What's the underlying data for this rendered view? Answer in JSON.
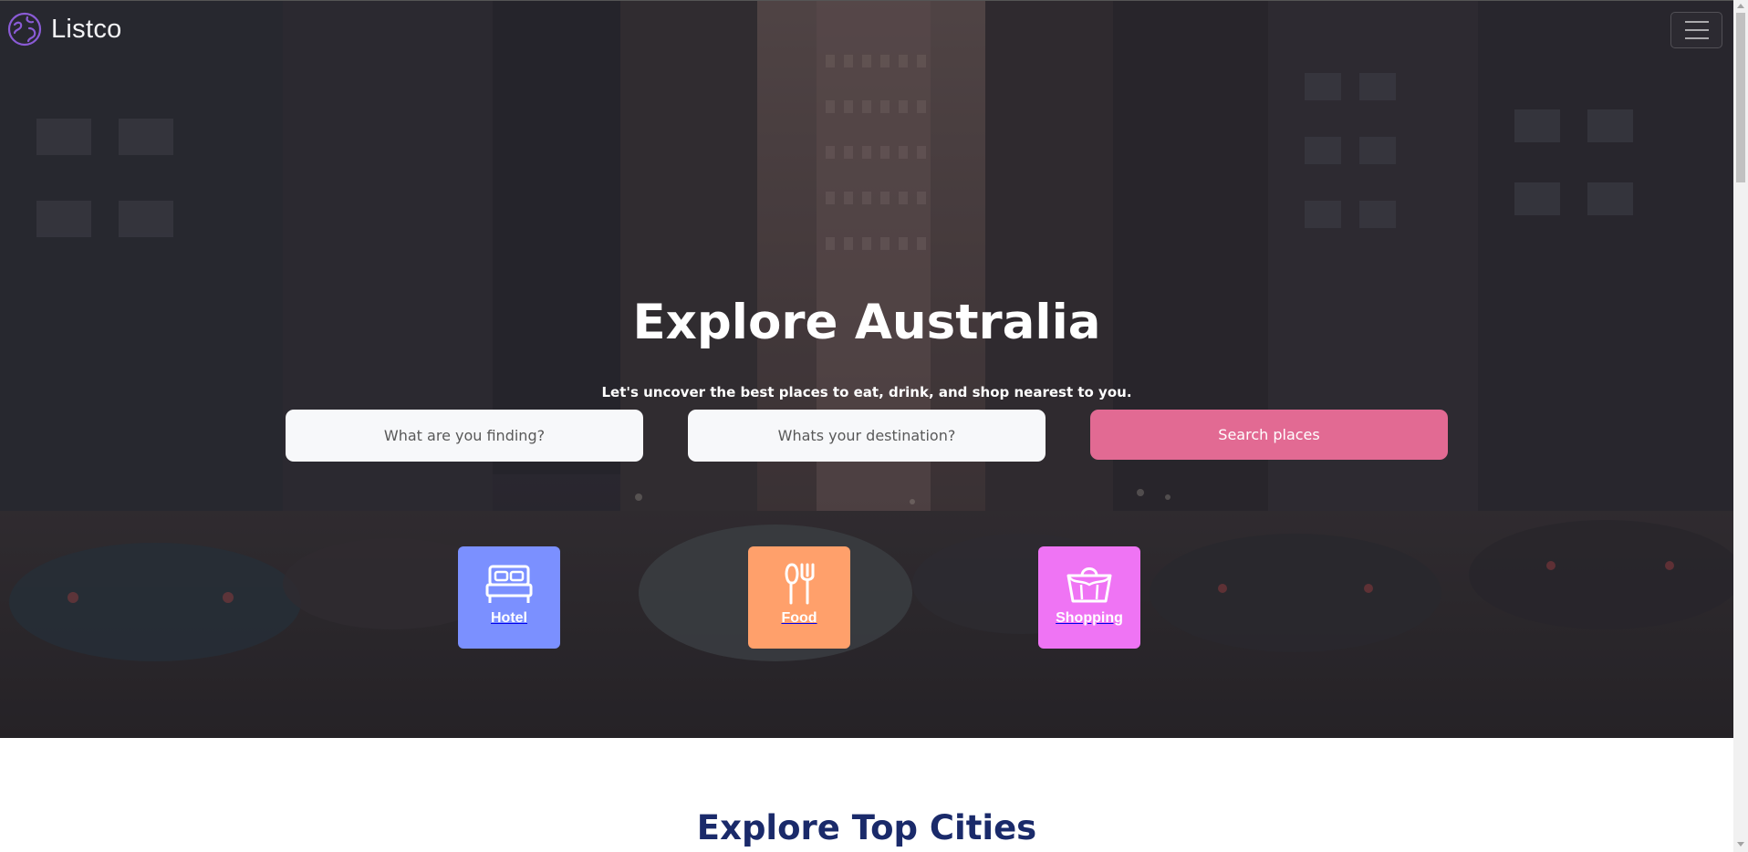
{
  "brand": {
    "name": "Listco",
    "icon": "globe-icon",
    "color": "#8a5bd6"
  },
  "navbar": {
    "toggler_icon": "hamburger-menu-icon"
  },
  "hero": {
    "title": "Explore Australia",
    "subtitle": "Let's uncover the best places to eat, drink, and shop nearest to you.",
    "search": {
      "what_placeholder": "What are you finding?",
      "what_value": "",
      "where_placeholder": "Whats your destination?",
      "where_value": "",
      "button_label": "Search places",
      "button_color": "#e26a93"
    },
    "categories": [
      {
        "label": "Hotel",
        "icon": "bed-icon",
        "color": "#7b90ff"
      },
      {
        "label": "Food",
        "icon": "fork-knife-icon",
        "color": "#ffa06b"
      },
      {
        "label": "Shopping",
        "icon": "shopping-basket-icon",
        "color": "#ef74f4"
      }
    ]
  },
  "sections": {
    "top_cities_title": "Explore Top Cities"
  },
  "colors": {
    "section_title": "#1a2a6a",
    "hero_overlay": "#2c2a31"
  }
}
